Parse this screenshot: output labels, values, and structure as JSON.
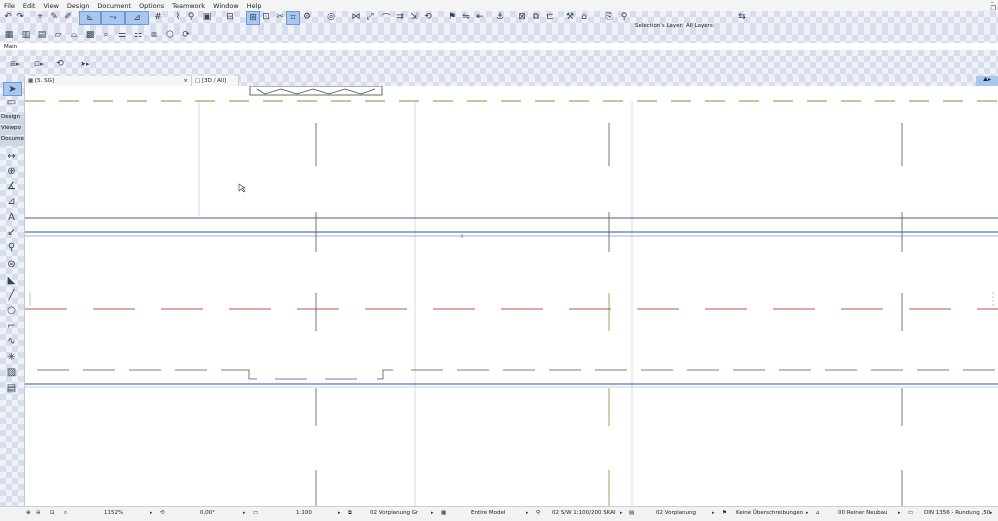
{
  "menu": [
    "File",
    "Edit",
    "View",
    "Design",
    "Document",
    "Options",
    "Teamwork",
    "Window",
    "Help"
  ],
  "window_controls": {
    "minimize": "–",
    "restore": "❐",
    "close": "✕"
  },
  "layers": {
    "selection_label": "Selection's Layer:",
    "all_label": "All Layers:"
  },
  "palette_label": "Main",
  "tabs": [
    {
      "label": "[5. SG]"
    },
    {
      "label": "[3D / All]"
    }
  ],
  "toolbox": {
    "nav": [
      "Design",
      "Viewpo",
      "Docume"
    ],
    "tools": [
      {
        "icon": "arrow-pointer-icon"
      },
      {
        "icon": "marquee-icon"
      },
      {
        "icon": "dimension-icon"
      },
      {
        "icon": "radial-dimension-icon"
      },
      {
        "icon": "angle-dimension-icon"
      },
      {
        "icon": "level-dimension-icon"
      },
      {
        "icon": "text-icon"
      },
      {
        "icon": "label-icon"
      },
      {
        "icon": "section-marker-icon"
      },
      {
        "icon": "change-marker-icon"
      },
      {
        "icon": "fill-icon"
      },
      {
        "icon": "line-icon"
      },
      {
        "icon": "circle-icon"
      },
      {
        "icon": "polyline-icon"
      },
      {
        "icon": "spline-icon"
      },
      {
        "icon": "hotspot-icon"
      },
      {
        "icon": "figure-icon"
      },
      {
        "icon": "drawing-icon"
      }
    ]
  },
  "status": {
    "zoom": "1152%",
    "angle": "0,00°",
    "scale": "1:100",
    "layer_combination": "02 Vorplanung Gr",
    "model_view": "Entire Model",
    "pen_set": "02 S/W 1:100/200 SKAI",
    "mvo": "02 Vorplanung",
    "renovation_filter": "Keine Überschreibungen",
    "renovation": "00 Reiner Neubau",
    "dimension": "DIN 1356 - Rundung ,50"
  },
  "colors": {
    "accent": "#a9c6ef",
    "accent_border": "#6a9ad8",
    "grid_blue": "#2c4db0",
    "dash_olive": "#8a8a2a",
    "dash_red": "#c0504d"
  }
}
